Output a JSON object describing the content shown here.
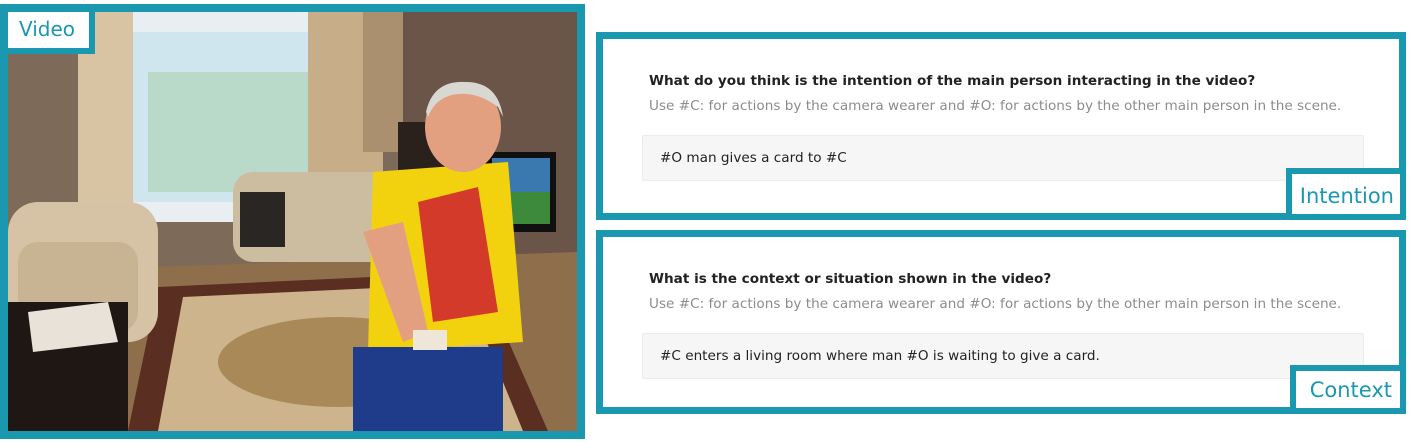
{
  "video": {
    "tag_label": "Video"
  },
  "intention": {
    "question": "What do you think is the intention of the main person interacting in the video?",
    "hint": "Use #C: for actions by the camera wearer and #O: for actions by the other main person in the scene.",
    "answer": "#O man gives a card to #C",
    "tag_label": "Intention"
  },
  "context": {
    "question": "What is the context or situation shown in the video?",
    "hint": "Use #C: for actions by the camera wearer and #O: for actions by the other main person in the scene.",
    "answer": "#C enters a living room where man #O is waiting to give a card.",
    "tag_label": "Context"
  },
  "colors": {
    "accent": "#1a98b0",
    "answer_bg": "#f6f6f6",
    "hint_text": "#8c8c8c"
  }
}
